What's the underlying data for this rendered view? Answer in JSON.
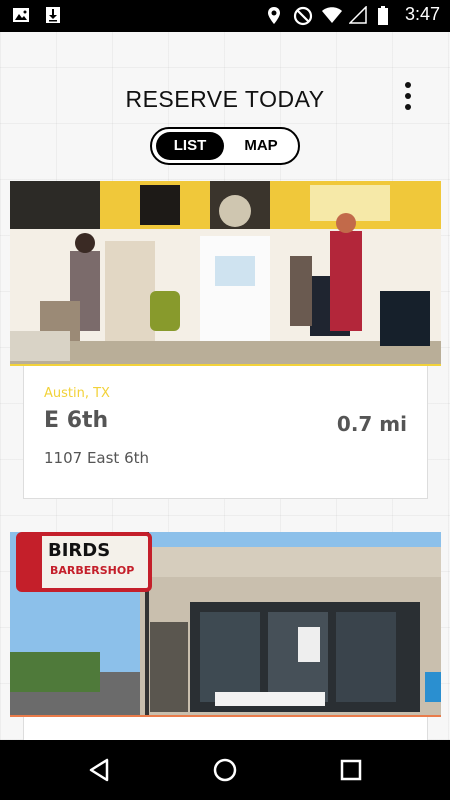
{
  "status_bar": {
    "time": "3:47",
    "icons": [
      "image-icon",
      "download-icon",
      "location-icon",
      "do-not-disturb-icon",
      "wifi-icon",
      "signal-icon",
      "battery-icon"
    ]
  },
  "header": {
    "title": "RESERVE TODAY",
    "menu_icon": "more-vert-icon"
  },
  "view_toggle": {
    "options": [
      "LIST",
      "MAP"
    ],
    "selected": "LIST"
  },
  "locations": [
    {
      "city": "Austin, TX",
      "name": "E 6th",
      "distance": "0.7 mi",
      "address": "1107 East 6th"
    },
    {
      "sign_title": "BIRDS",
      "sign_subtitle": "BARBERSHOP"
    }
  ],
  "nav_bar": {
    "buttons": [
      "back-icon",
      "home-icon",
      "recents-icon"
    ]
  },
  "colors": {
    "accent_yellow": "#f2d23a",
    "text_dark": "#111111",
    "text_gray": "#555555"
  }
}
